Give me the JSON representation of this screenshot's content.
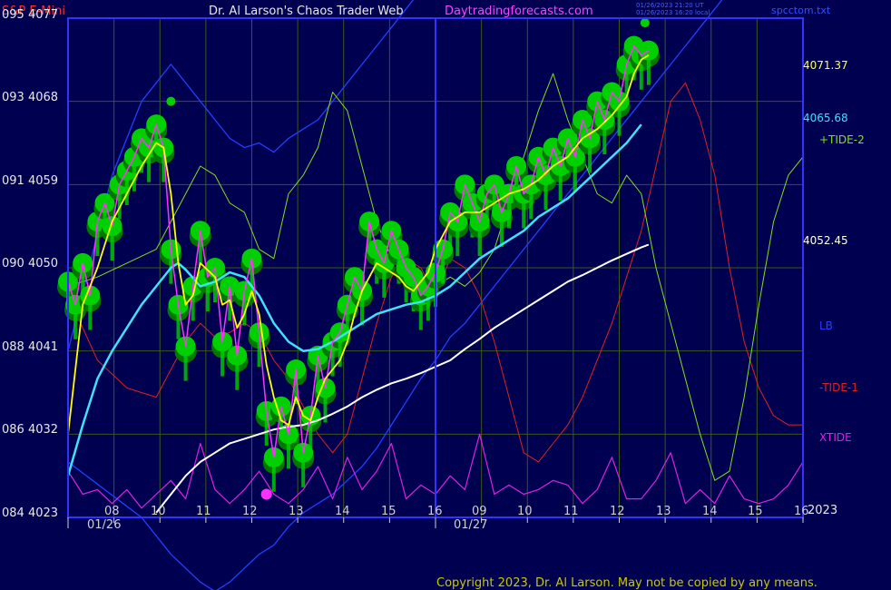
{
  "header": {
    "symbol": "S&P E-Mini",
    "author": "Dr. Al Larson's Chaos Trader Web",
    "site": "Daytradingforecasts.com",
    "stamp_line1": "01/26/2023 21:20 UT",
    "stamp_line2": "01/26/2023 16:20 local",
    "file": "spcctom.txt"
  },
  "left_axis_labels": [
    "095  4077",
    "093  4068",
    "091  4059",
    "090  4050",
    "088  4041",
    "086  4032",
    "084  4023"
  ],
  "right_labels": {
    "price_top": "4071.37",
    "price_ema": "4065.68",
    "tide2": "+TIDE-2",
    "price_mid": "4052.45",
    "lb": "LB",
    "tide1": "-TIDE-1",
    "xtide": "XTIDE",
    "year": "2023"
  },
  "x_axis": {
    "hour_labels": [
      "08",
      "10",
      "11",
      "12",
      "13",
      "14",
      "15",
      "16",
      "09",
      "10",
      "11",
      "12",
      "13",
      "14",
      "15",
      "16"
    ],
    "date_labels": [
      "01/26",
      "01/27"
    ]
  },
  "copyright": "Copyright 2023, Dr. Al Larson. May not be copied by any means.",
  "colors": {
    "background": "#000050",
    "frame": "#3232ff",
    "grid": "#3a5a1a",
    "green_ball": "#00d000",
    "green_ball_dark": "#007800",
    "price": "#ff30ff",
    "fast_avg": "#ffff00",
    "ema": "#40e0ff",
    "long_avg": "#ffffff",
    "tide2": "#80e020",
    "tide1": "#e02020",
    "lb": "#2040ff",
    "xtide": "#e020e0"
  },
  "chart_data": {
    "type": "line",
    "title": "S&P E-Mini",
    "y_range": [
      4023,
      4077
    ],
    "right_axis_prices": [
      4071.37,
      4065.68,
      4052.45
    ],
    "x_index_range": [
      0,
      100
    ],
    "series": [
      {
        "name": "price",
        "x": [
          0,
          1,
          2,
          3,
          4,
          5,
          6,
          7,
          8,
          9,
          10,
          11,
          12,
          13,
          14,
          15,
          16,
          17,
          18,
          19,
          20,
          21,
          22,
          23,
          24,
          25,
          26,
          27,
          28,
          29,
          30,
          31,
          32,
          33,
          34,
          35,
          36,
          37,
          38,
          39,
          40,
          41,
          42,
          43,
          44,
          45,
          46,
          47,
          48,
          49,
          50,
          51,
          52,
          53,
          54,
          55,
          56,
          57,
          58,
          59,
          60,
          61,
          62,
          63,
          64,
          65,
          66,
          67,
          68,
          69,
          70,
          71,
          72,
          73,
          74,
          75,
          76,
          77,
          78,
          79
        ],
        "values": [
          4048.5,
          4046,
          4050.5,
          4047,
          4055,
          4057,
          4054.5,
          4059,
          4060.5,
          4062,
          4064,
          4063,
          4065.5,
          4063,
          4052,
          4046,
          4041.5,
          4048,
          4054,
          4049,
          4050,
          4042,
          4048,
          4040.5,
          4047.5,
          4051,
          4043,
          4034.5,
          4029.5,
          4035,
          4032,
          4039,
          4030,
          4034,
          4040.5,
          4037,
          4042,
          4043,
          4046,
          4049,
          4047.5,
          4055,
          4052,
          4050.5,
          4054,
          4052,
          4050,
          4049,
          4047,
          4048,
          4049.5,
          4052,
          4056,
          4055,
          4059,
          4057,
          4055,
          4058,
          4059,
          4056,
          4058,
          4061,
          4058,
          4059,
          4062,
          4060,
          4063,
          4061,
          4064,
          4062,
          4066,
          4064,
          4068,
          4066,
          4069,
          4068,
          4072,
          4074,
          4073,
          4073.5
        ]
      },
      {
        "name": "fast_avg",
        "x": [
          0,
          2,
          4,
          6,
          8,
          10,
          12,
          13,
          14,
          15,
          16,
          17,
          18,
          20,
          21,
          22,
          23,
          24,
          25,
          26,
          27,
          28,
          29,
          30,
          31,
          32,
          33,
          34,
          35,
          36,
          37,
          38,
          39,
          40,
          41,
          42,
          43,
          44,
          45,
          46,
          47,
          48,
          49,
          50,
          52,
          54,
          56,
          58,
          60,
          62,
          64,
          66,
          68,
          70,
          72,
          74,
          76,
          77,
          78,
          79
        ],
        "values": [
          4032,
          4046,
          4050,
          4055,
          4058,
          4061,
          4063.5,
          4063,
          4058,
          4050.5,
          4046,
          4047,
          4050.5,
          4049,
          4046,
          4046.5,
          4043.5,
          4045,
          4047.5,
          4045,
          4039.5,
          4036,
          4033.5,
          4033,
          4036,
          4034,
          4033.5,
          4036,
          4038,
          4039,
          4040,
          4042,
          4045,
          4047.5,
          4049,
          4050.5,
          4050,
          4049.5,
          4049,
          4048,
          4047.5,
          4048.5,
          4049.5,
          4052,
          4055,
          4056,
          4056,
          4057,
          4058,
          4058.5,
          4059.5,
          4061,
          4062,
          4064,
          4065,
          4066.5,
          4068.5,
          4071,
          4072.5,
          4073
        ]
      },
      {
        "name": "ema",
        "x": [
          0,
          2,
          4,
          6,
          8,
          10,
          12,
          14,
          15,
          16,
          18,
          20,
          22,
          24,
          26,
          28,
          30,
          32,
          34,
          36,
          38,
          40,
          42,
          44,
          46,
          48,
          50,
          52,
          54,
          56,
          58,
          60,
          62,
          64,
          66,
          68,
          70,
          72,
          74,
          76,
          78
        ],
        "values": [
          4027.5,
          4033,
          4038,
          4041,
          4043.5,
          4046,
          4048,
          4050,
          4050.5,
          4049.8,
          4048,
          4048.5,
          4049.5,
          4049,
          4047,
          4044,
          4042,
          4041,
          4041.2,
          4042,
          4043,
          4044,
          4045,
          4045.5,
          4046,
          4046.3,
          4047,
          4048,
          4049.5,
          4051,
          4052,
          4053,
          4054,
          4055.5,
          4056.5,
          4057.5,
          4059,
          4060.5,
          4062,
          4063.5,
          4065.5
        ]
      },
      {
        "name": "long_avg",
        "x": [
          12,
          14,
          16,
          18,
          20,
          22,
          24,
          26,
          28,
          30,
          32,
          34,
          36,
          38,
          40,
          42,
          44,
          46,
          48,
          50,
          52,
          54,
          56,
          58,
          60,
          62,
          64,
          66,
          68,
          70,
          72,
          74,
          76,
          78,
          79
        ],
        "values": [
          4023.5,
          4025.5,
          4027.5,
          4029,
          4030,
          4031,
          4031.5,
          4032,
          4032.5,
          4032.8,
          4033,
          4033.5,
          4034.2,
          4035,
          4036,
          4036.8,
          4037.5,
          4038,
          4038.6,
          4039.3,
          4040,
          4041.2,
          4042.3,
          4043.5,
          4044.5,
          4045.5,
          4046.5,
          4047.5,
          4048.5,
          4049.2,
          4050,
          4050.8,
          4051.5,
          4052.2,
          4052.5
        ]
      },
      {
        "name": "+TIDE-2",
        "x": [
          0,
          4,
          8,
          12,
          14,
          16,
          18,
          20,
          22,
          24,
          26,
          28,
          30,
          32,
          34,
          36,
          38,
          40,
          42,
          44,
          46,
          48,
          50,
          52,
          54,
          56,
          58,
          60,
          62,
          64,
          66,
          68,
          70,
          72,
          74,
          76,
          78,
          80,
          82,
          84,
          86,
          88,
          90,
          92,
          94,
          96,
          98,
          100
        ],
        "values": [
          4048,
          4049,
          4050.5,
          4052,
          4055,
          4058,
          4061,
          4060,
          4057,
          4056,
          4052,
          4051,
          4058,
          4060,
          4063,
          4069,
          4067,
          4061,
          4055,
          4051,
          4049,
          4048,
          4048,
          4049,
          4048,
          4049.5,
          4052,
          4057,
          4062,
          4067,
          4071,
          4066,
          4062,
          4058,
          4057,
          4060,
          4058,
          4050,
          4044,
          4038,
          4032,
          4027,
          4028,
          4036,
          4046,
          4055,
          4060,
          4062
        ]
      },
      {
        "name": "-TIDE-1",
        "x": [
          0,
          4,
          8,
          12,
          14,
          16,
          18,
          20,
          22,
          24,
          26,
          28,
          30,
          32,
          34,
          36,
          38,
          40,
          42,
          44,
          46,
          48,
          50,
          52,
          54,
          56,
          58,
          60,
          62,
          64,
          66,
          68,
          70,
          72,
          74,
          76,
          78,
          80,
          82,
          84,
          86,
          88,
          90,
          92,
          94,
          96,
          98,
          100
        ],
        "values": [
          4047,
          4040,
          4037,
          4036,
          4039,
          4042,
          4044,
          4042.5,
          4043,
          4044,
          4043,
          4040,
          4038,
          4035,
          4032,
          4030,
          4032,
          4038,
          4044,
          4049,
          4051,
          4050,
          4047,
          4051,
          4050,
          4047,
          4042,
          4036,
          4030,
          4029,
          4031,
          4033,
          4036,
          4040,
          4044,
          4049,
          4054,
          4061,
          4068,
          4070,
          4066,
          4060,
          4050,
          4042,
          4037,
          4034,
          4033,
          4033
        ]
      },
      {
        "name": "LB",
        "x": [
          0,
          6,
          10,
          14,
          18,
          20,
          22,
          24,
          26,
          28,
          30,
          32,
          34,
          36,
          38,
          40,
          42,
          44,
          46,
          48,
          50,
          52,
          54,
          56,
          58,
          60,
          62,
          64,
          66,
          68,
          70,
          72,
          74,
          76,
          78,
          80,
          82,
          84,
          86,
          88,
          90,
          92,
          94,
          96,
          98,
          100
        ],
        "values": [
          4041,
          4060,
          4068,
          4072,
          4068,
          4066,
          4064,
          4063,
          4063.5,
          4062.5,
          4064,
          4065,
          4066,
          4068,
          4070,
          4072,
          4074,
          4076,
          4078,
          4080,
          4082,
          4084,
          4086,
          4088,
          4090,
          4092,
          4094,
          4096,
          4098,
          4100,
          4100,
          4100,
          4100,
          4100,
          4100,
          4100,
          4100,
          4100,
          4100,
          4100,
          4100,
          4100,
          4100,
          4100,
          4100,
          4100
        ]
      },
      {
        "name": "LB-lower",
        "x": [
          0,
          10,
          14,
          18,
          20,
          22,
          24,
          26,
          28,
          30,
          32,
          34,
          36,
          38,
          40,
          42,
          44,
          46,
          48,
          50,
          52,
          54,
          56,
          58,
          60,
          62,
          64,
          66,
          68,
          70,
          72,
          74,
          76,
          78,
          80,
          82,
          84,
          86,
          88,
          90,
          92,
          94,
          96,
          98,
          100
        ],
        "values": [
          4029,
          4023,
          4019,
          4016,
          4015,
          4016,
          4017.5,
          4019,
          4020,
          4022,
          4023.5,
          4024.5,
          4025.5,
          4027,
          4028.5,
          4030.5,
          4033,
          4035.5,
          4038,
          4040,
          4042.5,
          4044,
          4046,
          4048,
          4050,
          4052,
          4054,
          4056,
          4058,
          4060,
          4062,
          4064,
          4066,
          4068,
          4070,
          4072,
          4074,
          4076,
          4078,
          4080,
          4082,
          4084,
          4086,
          4088,
          4090
        ]
      },
      {
        "name": "XTIDE",
        "x": [
          0,
          2,
          4,
          6,
          8,
          10,
          12,
          14,
          16,
          18,
          20,
          22,
          24,
          26,
          28,
          30,
          32,
          34,
          36,
          38,
          40,
          42,
          44,
          46,
          48,
          50,
          52,
          54,
          56,
          58,
          60,
          62,
          64,
          66,
          68,
          70,
          72,
          74,
          76,
          78,
          80,
          82,
          84,
          86,
          88,
          90,
          92,
          94,
          96,
          98,
          100
        ],
        "values": [
          4028,
          4025.5,
          4026,
          4024.5,
          4026,
          4024,
          4025.5,
          4027,
          4025,
          4031,
          4026,
          4024.5,
          4026,
          4028,
          4025.5,
          4024.5,
          4026,
          4028.5,
          4025,
          4029.5,
          4026,
          4028,
          4031,
          4025,
          4026.5,
          4025.5,
          4027.5,
          4026,
          4032,
          4025.5,
          4026.5,
          4025.5,
          4026,
          4027,
          4026.5,
          4024.5,
          4026,
          4029.5,
          4025,
          4025,
          4027,
          4030,
          4024.5,
          4026,
          4024.5,
          4027.5,
          4025,
          4024.5,
          4025,
          4026.5,
          4029
        ]
      }
    ],
    "markers": [
      {
        "name": "low-dot",
        "x": 27,
        "value": 4025.5
      },
      {
        "name": "high-dot-1",
        "x": 14,
        "value": 4068
      },
      {
        "name": "high-dot-2",
        "x": 78.5,
        "value": 4076.5
      }
    ],
    "green_balls_follow": "price"
  }
}
